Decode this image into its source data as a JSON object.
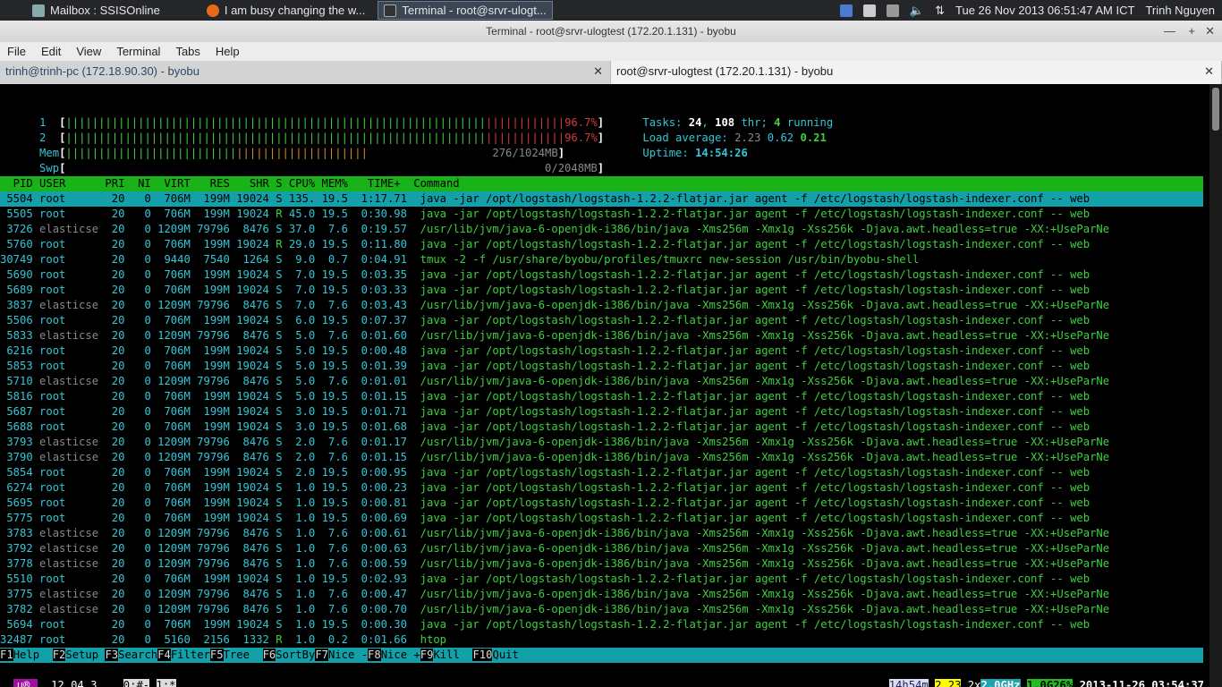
{
  "taskbar": {
    "apps": [
      {
        "label": "Mailbox : SSISOnline",
        "icon": "mail-icon"
      },
      {
        "label": "I am busy changing the w...",
        "icon": "firefox-icon"
      },
      {
        "label": "Terminal - root@srvr-ulogt...",
        "icon": "terminal-icon"
      }
    ],
    "clock": "Tue 26 Nov 2013 06:51:47 AM ICT",
    "user": "Trinh Nguyen"
  },
  "window": {
    "title": "Terminal - root@srvr-ulogtest (172.20.1.131) - byobu",
    "menus": [
      "File",
      "Edit",
      "View",
      "Terminal",
      "Tabs",
      "Help"
    ],
    "tabs": [
      "trinh@trinh-pc (172.18.90.30) - byobu",
      "root@srvr-ulogtest (172.20.1.131) - byobu"
    ]
  },
  "htop": {
    "cpu1_label": "1",
    "cpu2_label": "2",
    "cpu1_pct": "96.7%",
    "cpu2_pct": "96.7%",
    "mem_label": "Mem",
    "swp_label": "Swp",
    "mem_val": "276/1024MB",
    "swp_val": "0/2048MB",
    "tasks_label": "Tasks:",
    "tasks": "24",
    "thr": "108",
    "thr_label": "thr;",
    "running": "4",
    "running_label": "running",
    "load_label": "Load average:",
    "load1": "2.23",
    "load5": "0.62",
    "load15": "0.21",
    "uptime_label": "Uptime:",
    "uptime": "14:54:26",
    "header": "  PID USER      PRI  NI  VIRT   RES   SHR S CPU% MEM%   TIME+  Command",
    "rows": [
      [
        "5504",
        "root",
        "20",
        "0",
        "706M",
        "199M",
        "19024",
        "S",
        "135.",
        "19.5",
        "1:17.71",
        "java -jar /opt/logstash/logstash-1.2.2-flatjar.jar agent -f /etc/logstash/logstash-indexer.conf -- web"
      ],
      [
        "5505",
        "root",
        "20",
        "0",
        "706M",
        "199M",
        "19024",
        "R",
        "45.0",
        "19.5",
        "0:30.98",
        "java -jar /opt/logstash/logstash-1.2.2-flatjar.jar agent -f /etc/logstash/logstash-indexer.conf -- web"
      ],
      [
        "3726",
        "elasticse",
        "20",
        "0",
        "1209M",
        "79796",
        "8476",
        "S",
        "37.0",
        "7.6",
        "0:19.57",
        "/usr/lib/jvm/java-6-openjdk-i386/bin/java -Xms256m -Xmx1g -Xss256k -Djava.awt.headless=true -XX:+UseParNe"
      ],
      [
        "5760",
        "root",
        "20",
        "0",
        "706M",
        "199M",
        "19024",
        "R",
        "29.0",
        "19.5",
        "0:11.80",
        "java -jar /opt/logstash/logstash-1.2.2-flatjar.jar agent -f /etc/logstash/logstash-indexer.conf -- web"
      ],
      [
        "30749",
        "root",
        "20",
        "0",
        "9440",
        "7540",
        "1264",
        "S",
        "9.0",
        "0.7",
        "0:04.91",
        "tmux -2 -f /usr/share/byobu/profiles/tmuxrc new-session /usr/bin/byobu-shell"
      ],
      [
        "5690",
        "root",
        "20",
        "0",
        "706M",
        "199M",
        "19024",
        "S",
        "7.0",
        "19.5",
        "0:03.35",
        "java -jar /opt/logstash/logstash-1.2.2-flatjar.jar agent -f /etc/logstash/logstash-indexer.conf -- web"
      ],
      [
        "5689",
        "root",
        "20",
        "0",
        "706M",
        "199M",
        "19024",
        "S",
        "7.0",
        "19.5",
        "0:03.33",
        "java -jar /opt/logstash/logstash-1.2.2-flatjar.jar agent -f /etc/logstash/logstash-indexer.conf -- web"
      ],
      [
        "3837",
        "elasticse",
        "20",
        "0",
        "1209M",
        "79796",
        "8476",
        "S",
        "7.0",
        "7.6",
        "0:03.43",
        "/usr/lib/jvm/java-6-openjdk-i386/bin/java -Xms256m -Xmx1g -Xss256k -Djava.awt.headless=true -XX:+UseParNe"
      ],
      [
        "5506",
        "root",
        "20",
        "0",
        "706M",
        "199M",
        "19024",
        "S",
        "6.0",
        "19.5",
        "0:07.37",
        "java -jar /opt/logstash/logstash-1.2.2-flatjar.jar agent -f /etc/logstash/logstash-indexer.conf -- web"
      ],
      [
        "5833",
        "elasticse",
        "20",
        "0",
        "1209M",
        "79796",
        "8476",
        "S",
        "5.0",
        "7.6",
        "0:01.60",
        "/usr/lib/jvm/java-6-openjdk-i386/bin/java -Xms256m -Xmx1g -Xss256k -Djava.awt.headless=true -XX:+UseParNe"
      ],
      [
        "6216",
        "root",
        "20",
        "0",
        "706M",
        "199M",
        "19024",
        "S",
        "5.0",
        "19.5",
        "0:00.48",
        "java -jar /opt/logstash/logstash-1.2.2-flatjar.jar agent -f /etc/logstash/logstash-indexer.conf -- web"
      ],
      [
        "5853",
        "root",
        "20",
        "0",
        "706M",
        "199M",
        "19024",
        "S",
        "5.0",
        "19.5",
        "0:01.39",
        "java -jar /opt/logstash/logstash-1.2.2-flatjar.jar agent -f /etc/logstash/logstash-indexer.conf -- web"
      ],
      [
        "5710",
        "elasticse",
        "20",
        "0",
        "1209M",
        "79796",
        "8476",
        "S",
        "5.0",
        "7.6",
        "0:01.01",
        "/usr/lib/jvm/java-6-openjdk-i386/bin/java -Xms256m -Xmx1g -Xss256k -Djava.awt.headless=true -XX:+UseParNe"
      ],
      [
        "5816",
        "root",
        "20",
        "0",
        "706M",
        "199M",
        "19024",
        "S",
        "5.0",
        "19.5",
        "0:01.15",
        "java -jar /opt/logstash/logstash-1.2.2-flatjar.jar agent -f /etc/logstash/logstash-indexer.conf -- web"
      ],
      [
        "5687",
        "root",
        "20",
        "0",
        "706M",
        "199M",
        "19024",
        "S",
        "3.0",
        "19.5",
        "0:01.71",
        "java -jar /opt/logstash/logstash-1.2.2-flatjar.jar agent -f /etc/logstash/logstash-indexer.conf -- web"
      ],
      [
        "5688",
        "root",
        "20",
        "0",
        "706M",
        "199M",
        "19024",
        "S",
        "3.0",
        "19.5",
        "0:01.68",
        "java -jar /opt/logstash/logstash-1.2.2-flatjar.jar agent -f /etc/logstash/logstash-indexer.conf -- web"
      ],
      [
        "3793",
        "elasticse",
        "20",
        "0",
        "1209M",
        "79796",
        "8476",
        "S",
        "2.0",
        "7.6",
        "0:01.17",
        "/usr/lib/jvm/java-6-openjdk-i386/bin/java -Xms256m -Xmx1g -Xss256k -Djava.awt.headless=true -XX:+UseParNe"
      ],
      [
        "3790",
        "elasticse",
        "20",
        "0",
        "1209M",
        "79796",
        "8476",
        "S",
        "2.0",
        "7.6",
        "0:01.15",
        "/usr/lib/jvm/java-6-openjdk-i386/bin/java -Xms256m -Xmx1g -Xss256k -Djava.awt.headless=true -XX:+UseParNe"
      ],
      [
        "5854",
        "root",
        "20",
        "0",
        "706M",
        "199M",
        "19024",
        "S",
        "2.0",
        "19.5",
        "0:00.95",
        "java -jar /opt/logstash/logstash-1.2.2-flatjar.jar agent -f /etc/logstash/logstash-indexer.conf -- web"
      ],
      [
        "6274",
        "root",
        "20",
        "0",
        "706M",
        "199M",
        "19024",
        "S",
        "1.0",
        "19.5",
        "0:00.23",
        "java -jar /opt/logstash/logstash-1.2.2-flatjar.jar agent -f /etc/logstash/logstash-indexer.conf -- web"
      ],
      [
        "5695",
        "root",
        "20",
        "0",
        "706M",
        "199M",
        "19024",
        "S",
        "1.0",
        "19.5",
        "0:00.81",
        "java -jar /opt/logstash/logstash-1.2.2-flatjar.jar agent -f /etc/logstash/logstash-indexer.conf -- web"
      ],
      [
        "5775",
        "root",
        "20",
        "0",
        "706M",
        "199M",
        "19024",
        "S",
        "1.0",
        "19.5",
        "0:00.69",
        "java -jar /opt/logstash/logstash-1.2.2-flatjar.jar agent -f /etc/logstash/logstash-indexer.conf -- web"
      ],
      [
        "3783",
        "elasticse",
        "20",
        "0",
        "1209M",
        "79796",
        "8476",
        "S",
        "1.0",
        "7.6",
        "0:00.61",
        "/usr/lib/jvm/java-6-openjdk-i386/bin/java -Xms256m -Xmx1g -Xss256k -Djava.awt.headless=true -XX:+UseParNe"
      ],
      [
        "3792",
        "elasticse",
        "20",
        "0",
        "1209M",
        "79796",
        "8476",
        "S",
        "1.0",
        "7.6",
        "0:00.63",
        "/usr/lib/jvm/java-6-openjdk-i386/bin/java -Xms256m -Xmx1g -Xss256k -Djava.awt.headless=true -XX:+UseParNe"
      ],
      [
        "3778",
        "elasticse",
        "20",
        "0",
        "1209M",
        "79796",
        "8476",
        "S",
        "1.0",
        "7.6",
        "0:00.59",
        "/usr/lib/jvm/java-6-openjdk-i386/bin/java -Xms256m -Xmx1g -Xss256k -Djava.awt.headless=true -XX:+UseParNe"
      ],
      [
        "5510",
        "root",
        "20",
        "0",
        "706M",
        "199M",
        "19024",
        "S",
        "1.0",
        "19.5",
        "0:02.93",
        "java -jar /opt/logstash/logstash-1.2.2-flatjar.jar agent -f /etc/logstash/logstash-indexer.conf -- web"
      ],
      [
        "3775",
        "elasticse",
        "20",
        "0",
        "1209M",
        "79796",
        "8476",
        "S",
        "1.0",
        "7.6",
        "0:00.47",
        "/usr/lib/jvm/java-6-openjdk-i386/bin/java -Xms256m -Xmx1g -Xss256k -Djava.awt.headless=true -XX:+UseParNe"
      ],
      [
        "3782",
        "elasticse",
        "20",
        "0",
        "1209M",
        "79796",
        "8476",
        "S",
        "1.0",
        "7.6",
        "0:00.70",
        "/usr/lib/jvm/java-6-openjdk-i386/bin/java -Xms256m -Xmx1g -Xss256k -Djava.awt.headless=true -XX:+UseParNe"
      ],
      [
        "5694",
        "root",
        "20",
        "0",
        "706M",
        "199M",
        "19024",
        "S",
        "1.0",
        "19.5",
        "0:00.30",
        "java -jar /opt/logstash/logstash-1.2.2-flatjar.jar agent -f /etc/logstash/logstash-indexer.conf -- web"
      ],
      [
        "32487",
        "root",
        "20",
        "0",
        "5160",
        "2156",
        "1332",
        "R",
        "1.0",
        "0.2",
        "0:01.66",
        "htop"
      ]
    ],
    "fkeys": [
      {
        "key": "F1",
        "label": "Help  "
      },
      {
        "key": "F2",
        "label": "Setup "
      },
      {
        "key": "F3",
        "label": "Search"
      },
      {
        "key": "F4",
        "label": "Filter"
      },
      {
        "key": "F5",
        "label": "Tree  "
      },
      {
        "key": "F6",
        "label": "SortBy"
      },
      {
        "key": "F7",
        "label": "Nice -"
      },
      {
        "key": "F8",
        "label": "Nice +"
      },
      {
        "key": "F9",
        "label": "Kill  "
      },
      {
        "key": "F10",
        "label": "Quit  "
      }
    ]
  },
  "byobu": {
    "logo": "u®",
    "release": "12.04.3",
    "win0": "0:#-",
    "win1": "1:*",
    "uptime": "14h54m",
    "load": "2.23",
    "cpu": "2x",
    "freq": "2.0GHz",
    "mem": "1.0G26%",
    "datetime": "2013-11-26 03:54:37"
  }
}
